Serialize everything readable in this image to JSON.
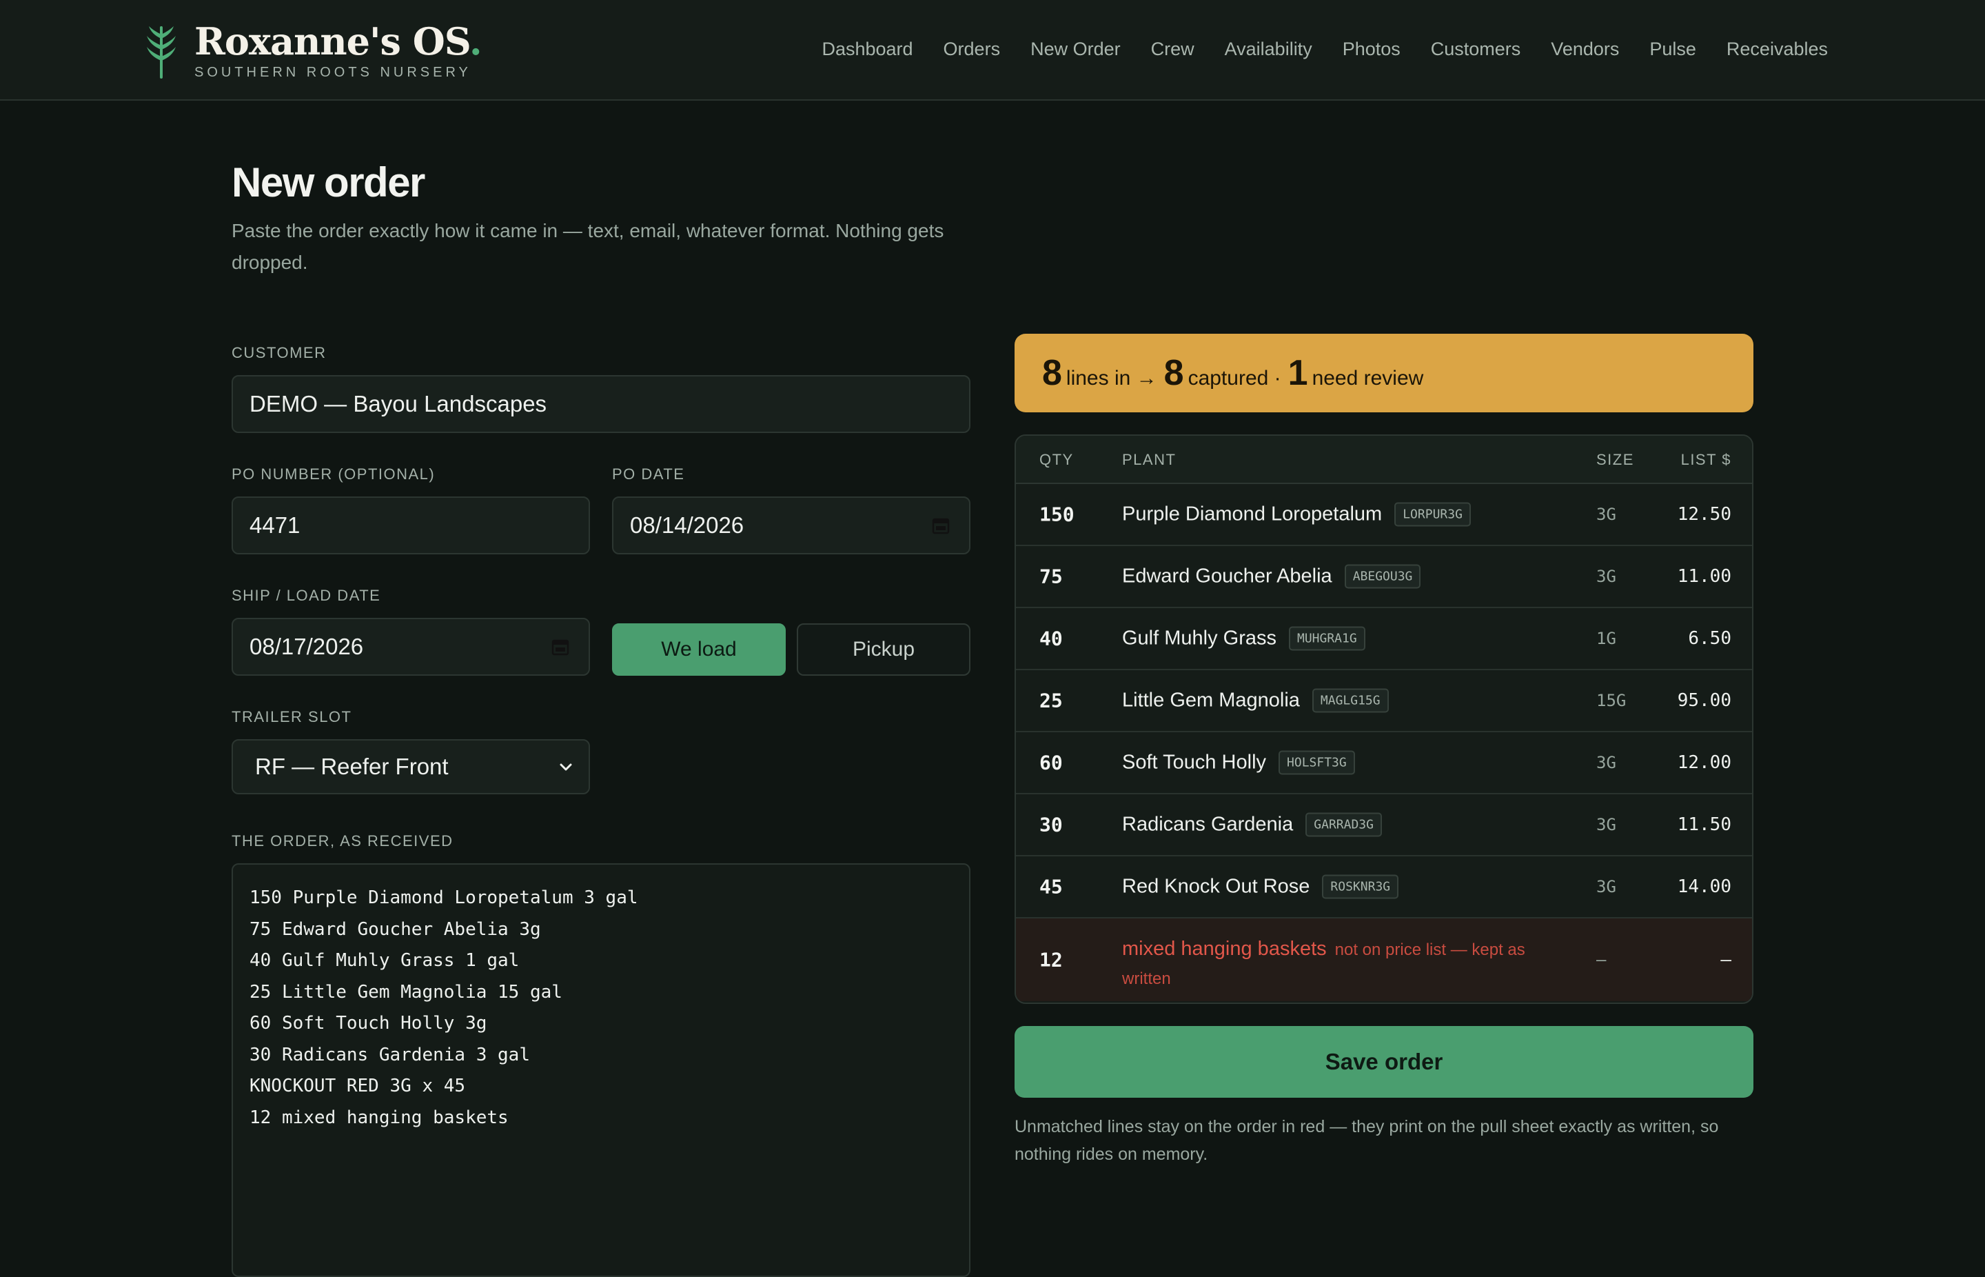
{
  "brand": {
    "name": "Roxanne's OS",
    "dot": ".",
    "tagline": "SOUTHERN ROOTS NURSERY"
  },
  "nav": [
    "Dashboard",
    "Orders",
    "New Order",
    "Crew",
    "Availability",
    "Photos",
    "Customers",
    "Vendors",
    "Pulse",
    "Receivables"
  ],
  "page": {
    "title": "New order",
    "subtitle": "Paste the order exactly how it came in — text, email, whatever format. Nothing gets dropped."
  },
  "form": {
    "customer_label": "Customer",
    "customer_value": "DEMO — Bayou Landscapes",
    "po_label": "PO Number (optional)",
    "po_value": "4471",
    "po_date_label": "PO Date",
    "po_date_value": "08/14/2026",
    "ship_label": "Ship / Load Date",
    "ship_value": "08/17/2026",
    "we_load": "We load",
    "pickup": "Pickup",
    "trailer_label": "Trailer Slot",
    "trailer_value": "RF — Reefer Front",
    "order_label": "The order, as received",
    "order_text": "150 Purple Diamond Loropetalum 3 gal\n75 Edward Goucher Abelia 3g\n40 Gulf Muhly Grass 1 gal\n25 Little Gem Magnolia 15 gal\n60 Soft Touch Holly 3g\n30 Radicans Gardenia 3 gal\nKNOCKOUT RED 3G x 45\n12 mixed hanging baskets"
  },
  "summary": {
    "lines_in": "8",
    "lines_in_text": "lines in →",
    "captured": "8",
    "captured_text": "captured ·",
    "review": "1",
    "review_text": "need review"
  },
  "table": {
    "headers": {
      "qty": "QTY",
      "plant": "PLANT",
      "size": "SIZE",
      "price": "LIST $"
    },
    "rows": [
      {
        "qty": "150",
        "plant": "Purple Diamond Loropetalum",
        "sku": "LORPUR3G",
        "size": "3G",
        "price": "12.50"
      },
      {
        "qty": "75",
        "plant": "Edward Goucher Abelia",
        "sku": "ABEGOU3G",
        "size": "3G",
        "price": "11.00"
      },
      {
        "qty": "40",
        "plant": "Gulf Muhly Grass",
        "sku": "MUHGRA1G",
        "size": "1G",
        "price": "6.50"
      },
      {
        "qty": "25",
        "plant": "Little Gem Magnolia",
        "sku": "MAGLG15G",
        "size": "15G",
        "price": "95.00"
      },
      {
        "qty": "60",
        "plant": "Soft Touch Holly",
        "sku": "HOLSFT3G",
        "size": "3G",
        "price": "12.00"
      },
      {
        "qty": "30",
        "plant": "Radicans Gardenia",
        "sku": "GARRAD3G",
        "size": "3G",
        "price": "11.50"
      },
      {
        "qty": "45",
        "plant": "Red Knock Out Rose",
        "sku": "ROSKNR3G",
        "size": "3G",
        "price": "14.00"
      }
    ],
    "unmatched": {
      "qty": "12",
      "plant": "mixed hanging baskets",
      "note": "not on price list — kept as written",
      "size": "–",
      "price": "–"
    }
  },
  "actions": {
    "save": "Save order",
    "footnote": "Unmatched lines stay on the order in red — they print on the pull sheet exactly as written, so nothing rides on memory."
  },
  "colors": {
    "accent_green": "#4a9e6f",
    "summary_amber": "#dba545",
    "unmatched_red": "#e2574a",
    "background": "#0f1512"
  }
}
